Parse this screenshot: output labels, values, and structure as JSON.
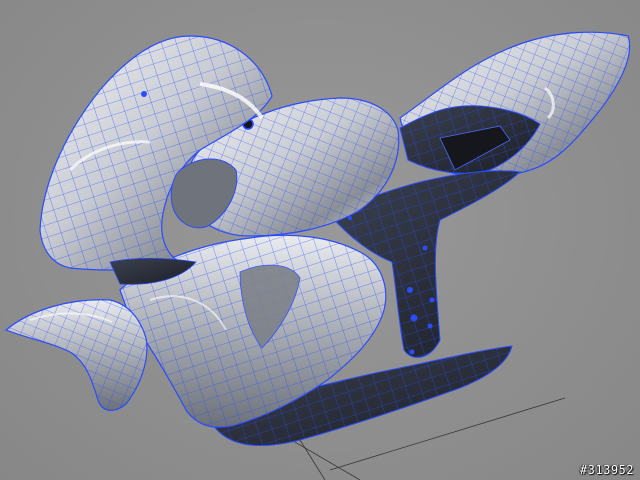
{
  "watermark": "#313952",
  "colors": {
    "background": "#8f8f8f",
    "wire": "#2a4cff",
    "shell_light": "#e4e6ea",
    "shell_dark": "#2b2f3a"
  }
}
